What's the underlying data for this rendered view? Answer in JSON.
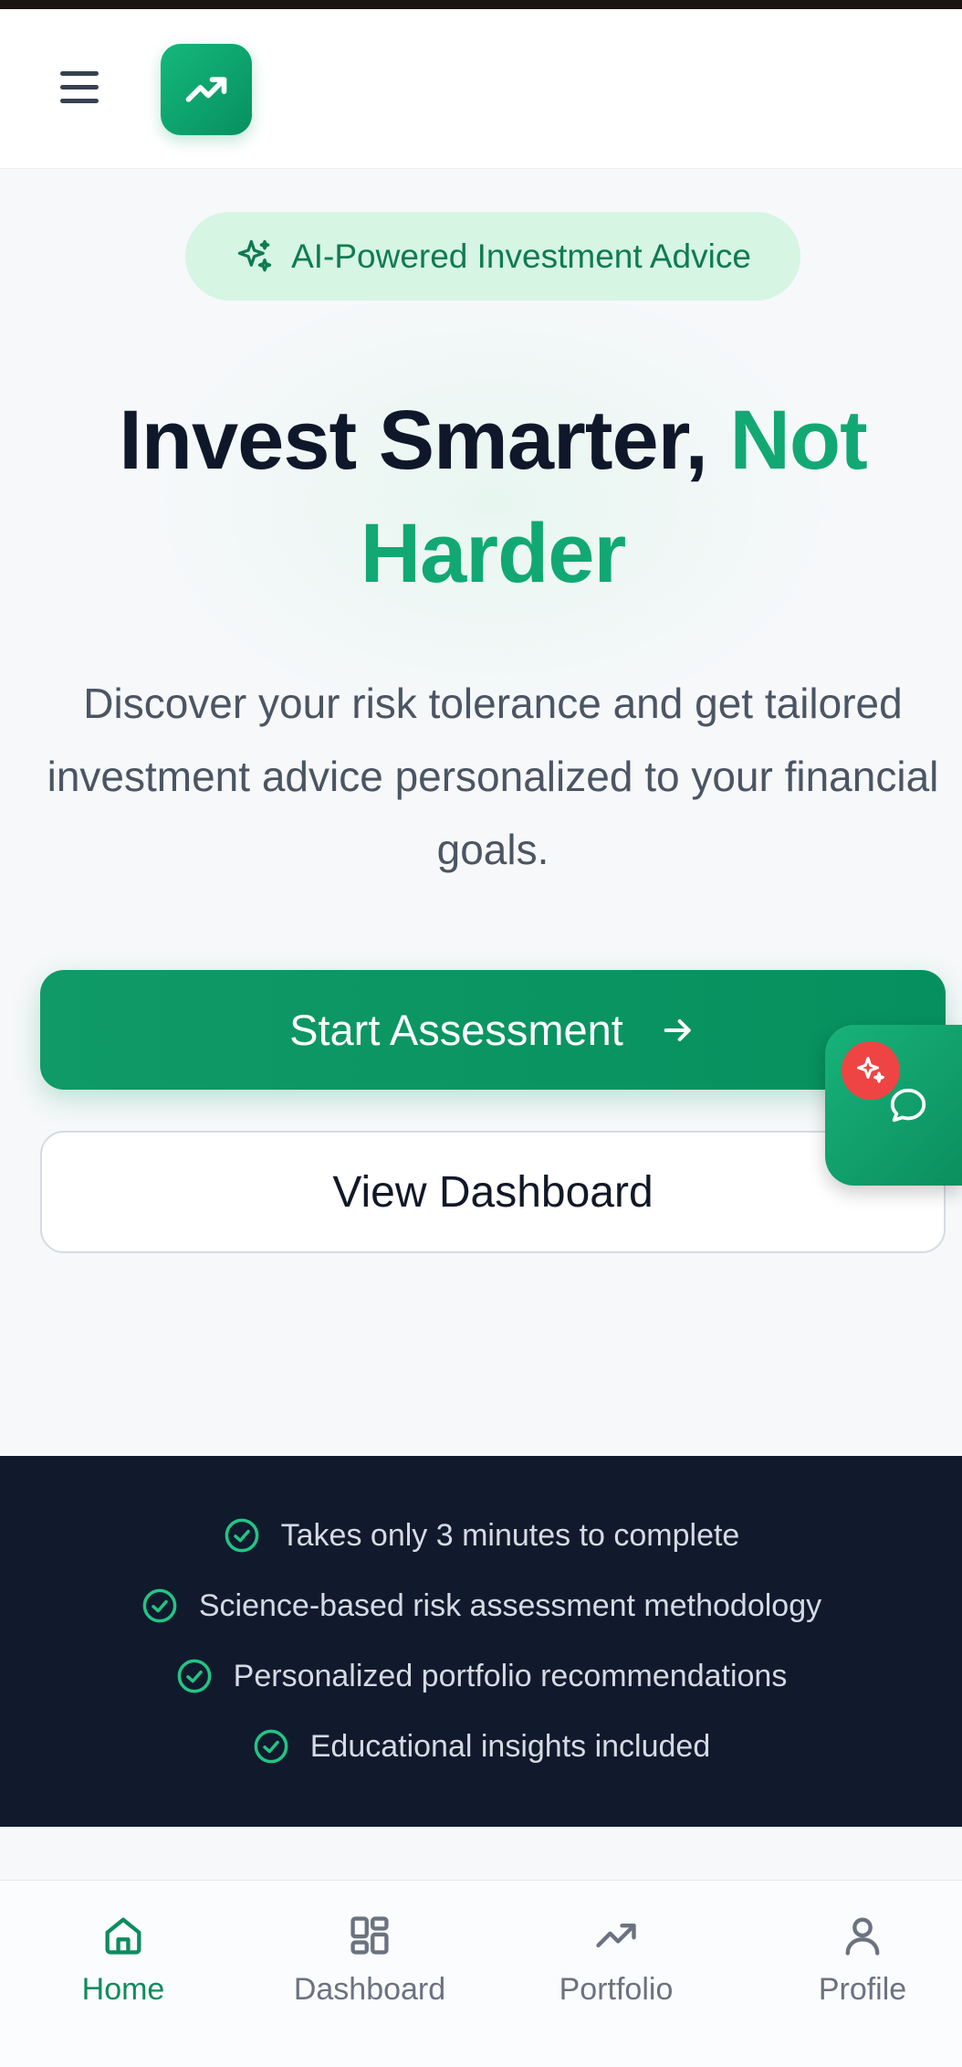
{
  "header": {
    "menu_icon": "hamburger-menu-icon",
    "logo_icon": "trending-up-icon"
  },
  "badge": {
    "icon": "sparkles-icon",
    "text": "AI-Powered Investment Advice"
  },
  "hero": {
    "title_main": "Invest Smarter, ",
    "title_accent": "Not Harder",
    "subtitle": "Discover your risk tolerance and get tailored investment advice personalized to your financial goals."
  },
  "actions": {
    "primary_label": "Start Assessment",
    "primary_icon": "arrow-right-icon",
    "secondary_label": "View Dashboard"
  },
  "chat_fab": {
    "icon": "chat-bubble-icon",
    "badge_icon": "sparkles-icon"
  },
  "features": [
    "Takes only 3 minutes to complete",
    "Science-based risk assessment methodology",
    "Personalized portfolio recommendations",
    "Educational insights included"
  ],
  "bottom_nav": [
    {
      "label": "Home",
      "icon": "home-icon",
      "active": true
    },
    {
      "label": "Dashboard",
      "icon": "grid-icon",
      "active": false
    },
    {
      "label": "Portfolio",
      "icon": "trending-up-icon",
      "active": false
    },
    {
      "label": "Profile",
      "icon": "user-icon",
      "active": false
    }
  ],
  "colors": {
    "brand": "#10a06b",
    "brand_dark": "#07905f",
    "badge_bg": "#d6f5e3",
    "dark_band": "#111a2d",
    "notification": "#ef4444"
  }
}
